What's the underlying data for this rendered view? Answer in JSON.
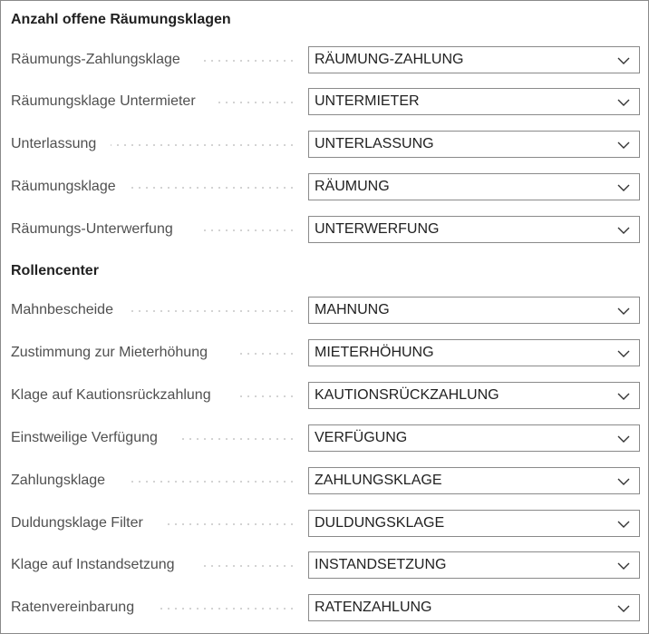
{
  "sections": [
    {
      "title": "Anzahl offene Räumungsklagen",
      "fields": [
        {
          "label": "Räumungs-Zahlungsklage",
          "value": "RÄUMUNG-ZAHLUNG"
        },
        {
          "label": "Räumungsklage Untermieter",
          "value": "UNTERMIETER"
        },
        {
          "label": "Unterlassung",
          "value": "UNTERLASSUNG"
        },
        {
          "label": "Räumungsklage",
          "value": "RÄUMUNG"
        },
        {
          "label": "Räumungs-Unterwerfung",
          "value": "UNTERWERFUNG"
        }
      ]
    },
    {
      "title": "Rollencenter",
      "fields": [
        {
          "label": "Mahnbescheide",
          "value": "MAHNUNG"
        },
        {
          "label": "Zustimmung zur Mieterhöhung",
          "value": "MIETERHÖHUNG"
        },
        {
          "label": "Klage auf Kautionsrückzahlung",
          "value": "KAUTIONSRÜCKZAHLUNG"
        },
        {
          "label": "Einstweilige Verfügung",
          "value": "VERFÜGUNG"
        },
        {
          "label": "Zahlungsklage",
          "value": "ZAHLUNGSKLAGE"
        },
        {
          "label": "Duldungsklage Filter",
          "value": "DULDUNGSKLAGE"
        },
        {
          "label": "Klage auf Instandsetzung",
          "value": "INSTANDSETZUNG"
        },
        {
          "label": "Ratenvereinbarung",
          "value": "RATENZAHLUNG"
        }
      ]
    }
  ],
  "icons": {
    "dropdown": "chevron-down-icon"
  }
}
